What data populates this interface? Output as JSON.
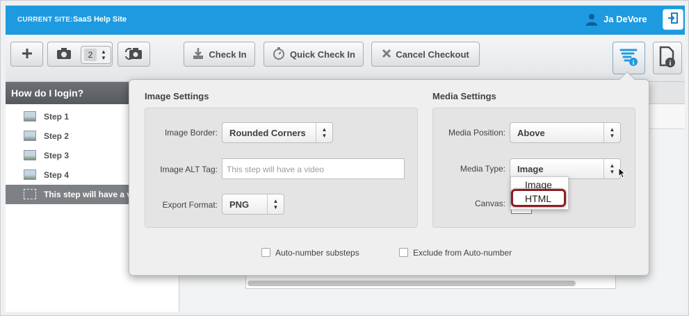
{
  "header": {
    "current_site_label": "CURRENT SITE:",
    "current_site_name": "SaaS Help Site",
    "user_name": "Ja DeVore",
    "icons": {
      "user": "user-icon",
      "logout": "logout-icon"
    },
    "colors": {
      "bar": "#1e9be0"
    }
  },
  "toolbar": {
    "add_icon": "plus-icon",
    "camera_icon": "camera-icon",
    "capture_count": "2",
    "recapture_icon": "camera-swap-icon",
    "check_in_label": "Check In",
    "quick_check_in_label": "Quick Check In",
    "cancel_checkout_label": "Cancel Checkout",
    "settings_icon": "step-settings-icon",
    "page_info_icon": "page-info-icon"
  },
  "left_panel": {
    "title": "How do I login?",
    "steps": [
      {
        "label": "Step 1"
      },
      {
        "label": "Step 2"
      },
      {
        "label": "Step 3"
      },
      {
        "label": "Step 4"
      },
      {
        "label": "This step will have a v"
      }
    ]
  },
  "popover": {
    "image_settings": {
      "title": "Image Settings",
      "border_label": "Image Border:",
      "border_value": "Rounded Corners",
      "alt_label": "Image ALT Tag:",
      "alt_value": "This step will have a video",
      "format_label": "Export Format:",
      "format_value": "PNG"
    },
    "media_settings": {
      "title": "Media Settings",
      "position_label": "Media Position:",
      "position_value": "Above",
      "type_label": "Media Type:",
      "type_value": "Image",
      "canvas_label": "Canvas:",
      "type_options": [
        "Image",
        "HTML"
      ],
      "highlight_color": "#8c1c24"
    },
    "auto_number_label": "Auto-number substeps",
    "exclude_label": "Exclude from Auto-number"
  }
}
